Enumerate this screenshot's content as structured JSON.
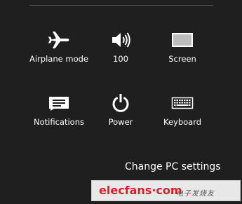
{
  "settings_tiles": [
    {
      "label": "Airplane mode",
      "icon": "airplane-icon"
    },
    {
      "label": "100",
      "icon": "volume-icon"
    },
    {
      "label": "Screen",
      "icon": "screen-icon"
    },
    {
      "label": "Notifications",
      "icon": "notifications-icon"
    },
    {
      "label": "Power",
      "icon": "power-icon"
    },
    {
      "label": "Keyboard",
      "icon": "keyboard-icon"
    }
  ],
  "change_pc_settings": "Change PC settings",
  "watermark": {
    "brand": "elecfans·com",
    "tagline": "电子发烧友",
    "brand_color": "#d71f27"
  },
  "colors": {
    "background": "#1f1f1f",
    "text": "#ffffff"
  }
}
